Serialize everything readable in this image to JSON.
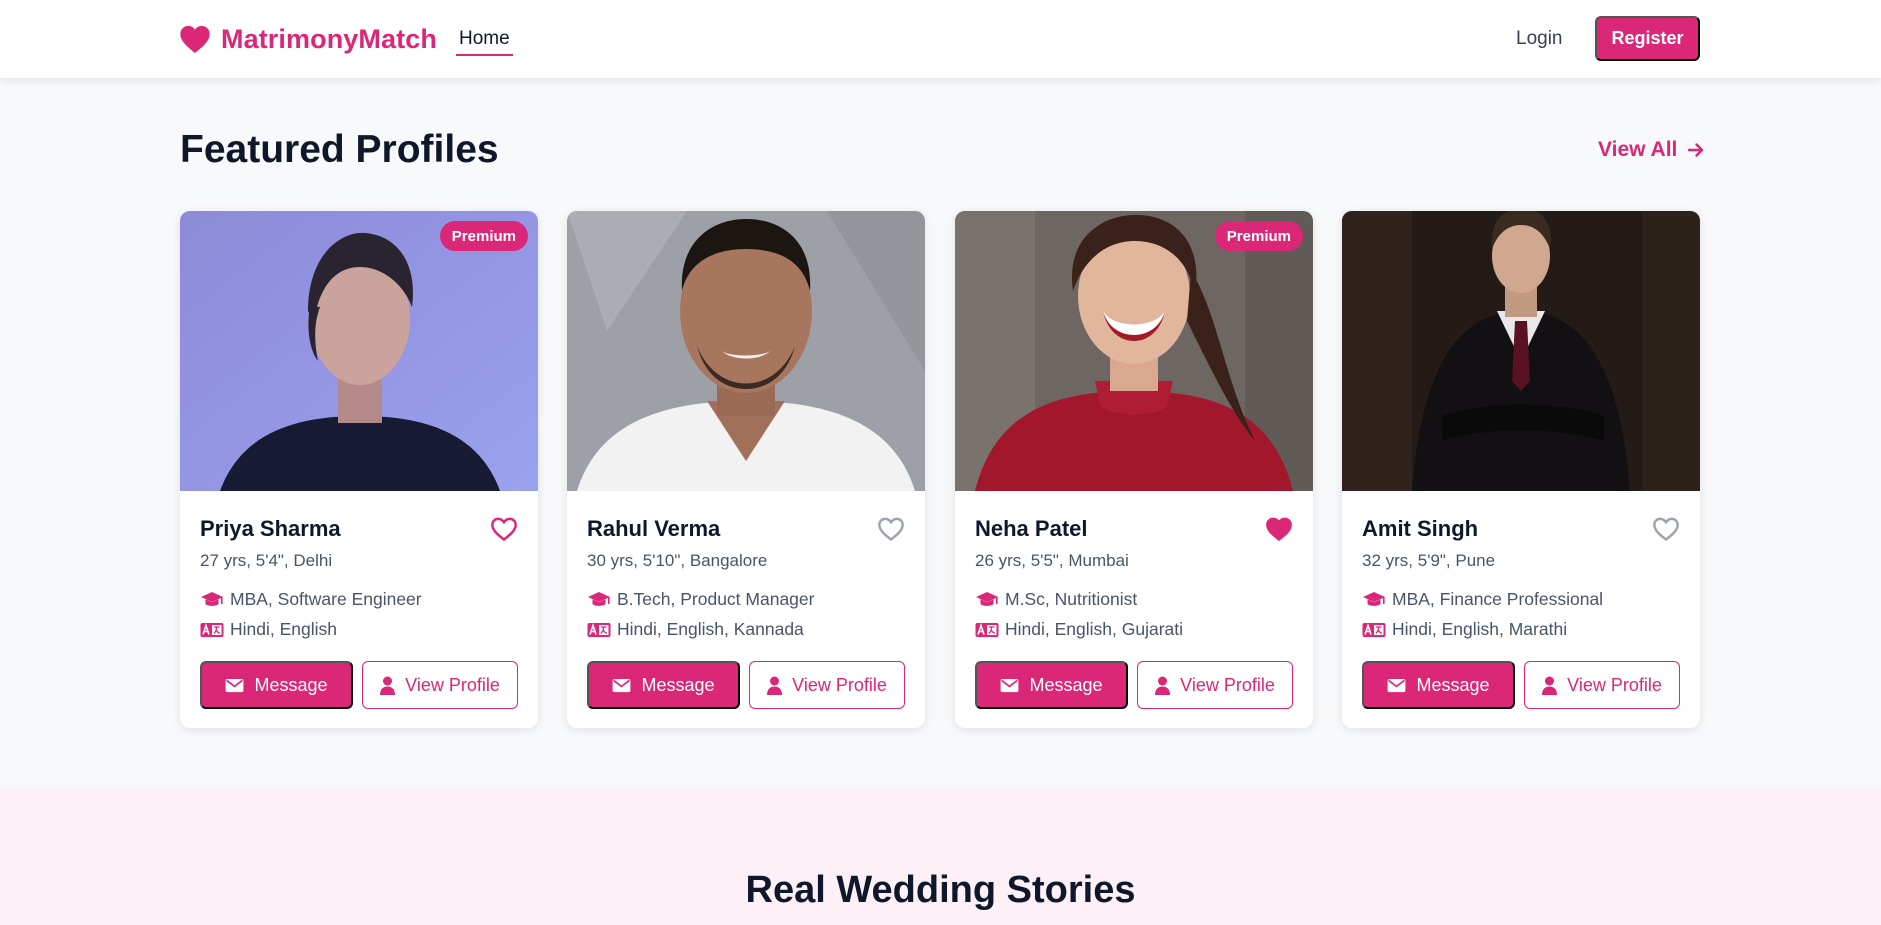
{
  "header": {
    "brand": "MatrimonyMatch",
    "nav_home": "Home",
    "login": "Login",
    "register": "Register"
  },
  "featured": {
    "title": "Featured Profiles",
    "view_all": "View All",
    "profiles": [
      {
        "name": "Priya Sharma",
        "meta": "27 yrs, 5'4\", Delhi",
        "education": "MBA, Software Engineer",
        "languages": "Hindi, English",
        "badge": "Premium",
        "favorited": false,
        "message_label": "Message",
        "view_label": "View Profile"
      },
      {
        "name": "Rahul Verma",
        "meta": "30 yrs, 5'10\", Bangalore",
        "education": "B.Tech, Product Manager",
        "languages": "Hindi, English, Kannada",
        "badge": "",
        "favorited": false,
        "message_label": "Message",
        "view_label": "View Profile"
      },
      {
        "name": "Neha Patel",
        "meta": "26 yrs, 5'5\", Mumbai",
        "education": "M.Sc, Nutritionist",
        "languages": "Hindi, English, Gujarati",
        "badge": "Premium",
        "favorited": true,
        "message_label": "Message",
        "view_label": "View Profile"
      },
      {
        "name": "Amit Singh",
        "meta": "32 yrs, 5'9\", Pune",
        "education": "MBA, Finance Professional",
        "languages": "Hindi, English, Marathi",
        "badge": "",
        "favorited": false,
        "message_label": "Message",
        "view_label": "View Profile"
      }
    ]
  },
  "stories": {
    "title": "Real Wedding Stories"
  },
  "colors": {
    "accent": "#db2777",
    "heading": "#0f172a",
    "muted": "#475569",
    "stories_bg": "#fdf0f6"
  },
  "icons": {
    "brand": "heart-icon",
    "view_all": "arrow-right-icon",
    "favorite": "heart-icon",
    "education": "graduation-cap-icon",
    "languages": "language-icon",
    "message": "envelope-icon",
    "view_profile": "user-icon"
  }
}
